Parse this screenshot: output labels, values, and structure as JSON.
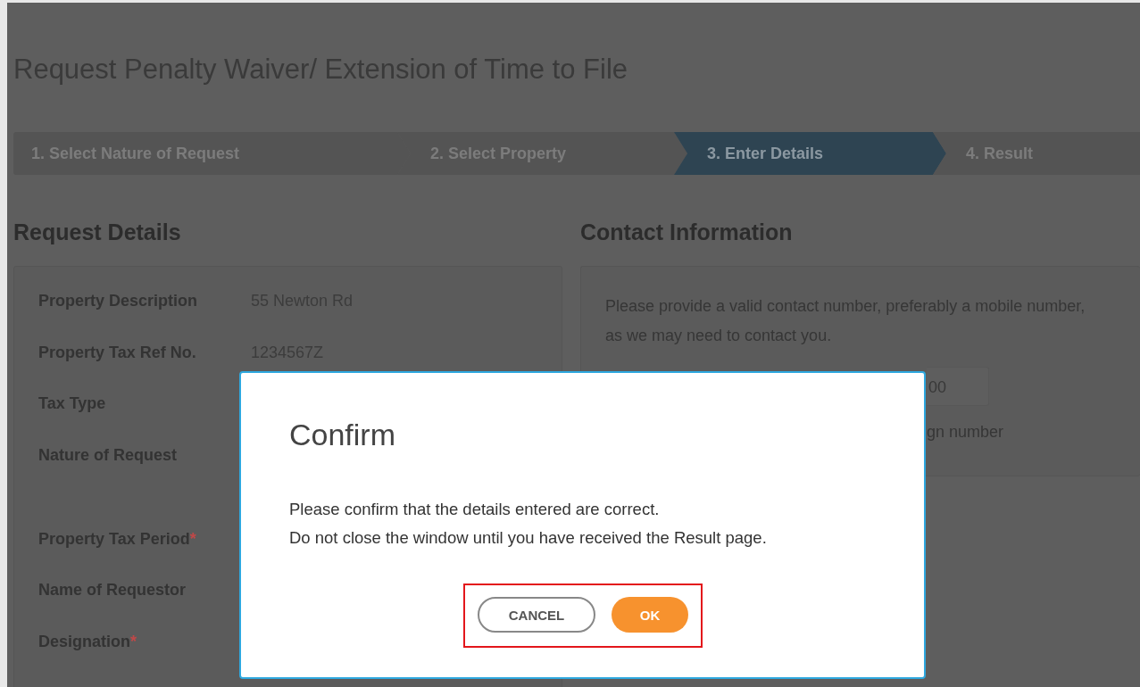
{
  "page_title": "Request Penalty Waiver/ Extension of Time to File",
  "steps": [
    {
      "label": "1.  Select Nature of Request",
      "selected": false
    },
    {
      "label": "2.  Select Property",
      "selected": false
    },
    {
      "label": "3.  Enter Details",
      "selected": true
    },
    {
      "label": "4.  Result",
      "selected": false
    }
  ],
  "request_details": {
    "heading": "Request Details",
    "rows": [
      {
        "label": "Property Description",
        "value": "55 Newton Rd"
      },
      {
        "label": "Property Tax Ref No.",
        "value": "1234567Z"
      },
      {
        "label": "Tax Type"
      },
      {
        "label": "Nature of Request"
      },
      {
        "label": "Property Tax Period",
        "required_mark": "*"
      },
      {
        "label": "Name of Requestor"
      },
      {
        "label": "Designation",
        "required_mark": "*"
      }
    ]
  },
  "contact_information": {
    "heading": "Contact Information",
    "note": "Please provide a valid contact number, preferably a mobile number, as we may need to contact you.",
    "phone_value": "00",
    "foreign_label": "gn number"
  },
  "dialog": {
    "title": "Confirm",
    "lines": [
      "Please confirm that the details entered are correct.",
      "Do not close the window until you have received the Result page."
    ],
    "buttons": [
      {
        "label": "CANCEL",
        "kind": "secondary"
      },
      {
        "label": "OK",
        "kind": "primary"
      }
    ]
  }
}
